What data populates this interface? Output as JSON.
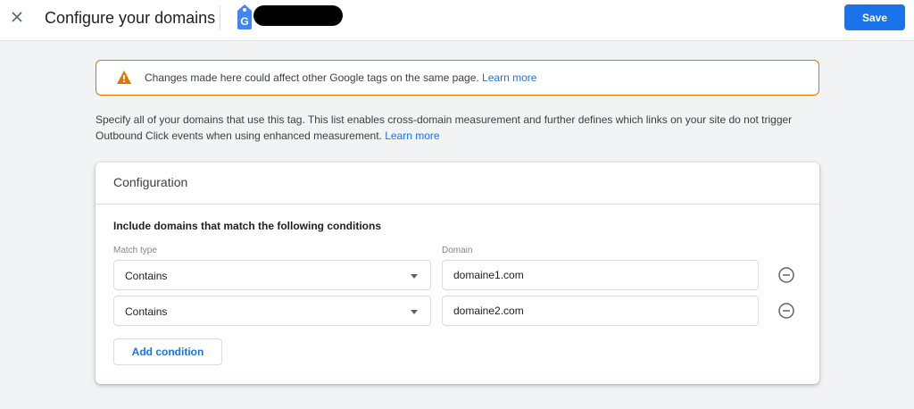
{
  "header": {
    "title": "Configure your domains",
    "save_label": "Save",
    "close_icon": "close-icon",
    "tag_icon": "google-tag-icon"
  },
  "warning": {
    "text": "Changes made here could affect other Google tags on the same page.",
    "link": "Learn more",
    "icon": "warning-icon",
    "color": "#e37400"
  },
  "description": {
    "text": "Specify all of your domains that use this tag. This list enables cross-domain measurement and further defines which links on your site do not trigger Outbound Click events when using enhanced measurement.",
    "link": "Learn more"
  },
  "configuration": {
    "title": "Configuration",
    "section_title": "Include domains that match the following conditions",
    "match_type_label": "Match type",
    "domain_label": "Domain",
    "conditions": [
      {
        "match_type": "Contains",
        "domain": "domaine1.com"
      },
      {
        "match_type": "Contains",
        "domain": "domaine2.com"
      }
    ],
    "add_condition_label": "Add condition"
  },
  "colors": {
    "accent": "#1a73e8",
    "background": "#f1f3f4"
  }
}
